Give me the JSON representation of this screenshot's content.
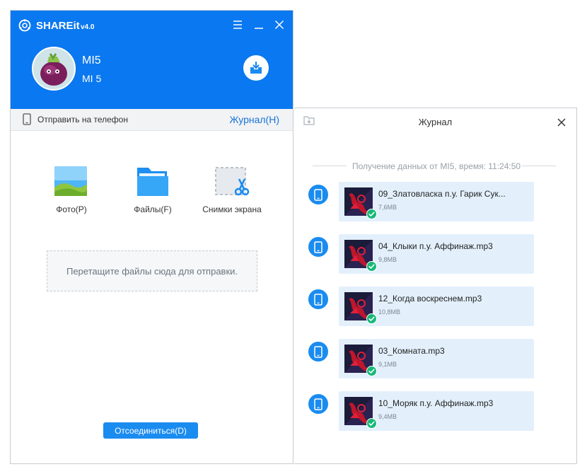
{
  "app": {
    "title": "SHAREit",
    "version": "v4.0",
    "colors": {
      "accent": "#0a78f0",
      "button": "#1a8cf0",
      "card": "#e3f0fc",
      "success": "#17b978"
    }
  },
  "device": {
    "name": "MI5",
    "model": "MI 5"
  },
  "toolbar": {
    "send_label": "Отправить на телефон",
    "journal_link": "Журнал(H)"
  },
  "tools": [
    {
      "label": "Фото(P)",
      "icon": "photo-icon"
    },
    {
      "label": "Файлы(F)",
      "icon": "folder-icon"
    },
    {
      "label": "Снимки экрана",
      "icon": "screenshot-icon"
    }
  ],
  "drop_zone": {
    "text": "Перетащите файлы сюда для отправки."
  },
  "disconnect_label": "Отсоединиться(D)",
  "journal": {
    "title": "Журнал",
    "session_header": "Получение данных от MI5, время: 11:24:50",
    "entries": [
      {
        "name": "09_Златовласка п.у. Гарик Сук...",
        "size": "7,6MB"
      },
      {
        "name": "04_Клыки п.у. Аффинаж.mp3",
        "size": "9,8MB"
      },
      {
        "name": "12_Когда воскреснем.mp3",
        "size": "10,8MB"
      },
      {
        "name": "03_Комната.mp3",
        "size": "9,1MB"
      },
      {
        "name": "10_Моряк п.у. Аффинаж.mp3",
        "size": "9,4MB"
      }
    ]
  }
}
